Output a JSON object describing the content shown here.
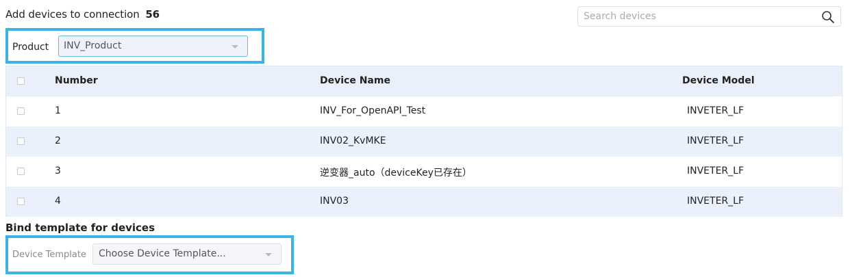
{
  "header": {
    "title": "Add devices to connection",
    "connection_number": "56"
  },
  "search": {
    "placeholder": "Search devices",
    "icon": "search-icon"
  },
  "product_filter": {
    "label": "Product",
    "selected": "INV_Product"
  },
  "table": {
    "columns": [
      "Number",
      "Device Name",
      "Device Model"
    ],
    "rows": [
      {
        "number": "1",
        "device_name": "INV_For_OpenAPI_Test",
        "device_model": "INVETER_LF"
      },
      {
        "number": "2",
        "device_name": "INV02_KvMKE",
        "device_model": "INVETER_LF"
      },
      {
        "number": "3",
        "device_name": "逆变器_auto（deviceKey已存在）",
        "device_model": "INVETER_LF"
      },
      {
        "number": "4",
        "device_name": "INV03",
        "device_model": "INVETER_LF"
      }
    ]
  },
  "bind_template": {
    "title": "Bind template for devices",
    "label": "Device Template",
    "placeholder": "Choose Device Template..."
  },
  "colors": {
    "highlight": "#3ab4e6",
    "header_row_bg": "#e9f0fb",
    "striped_row_bg": "#eaf1fc"
  }
}
